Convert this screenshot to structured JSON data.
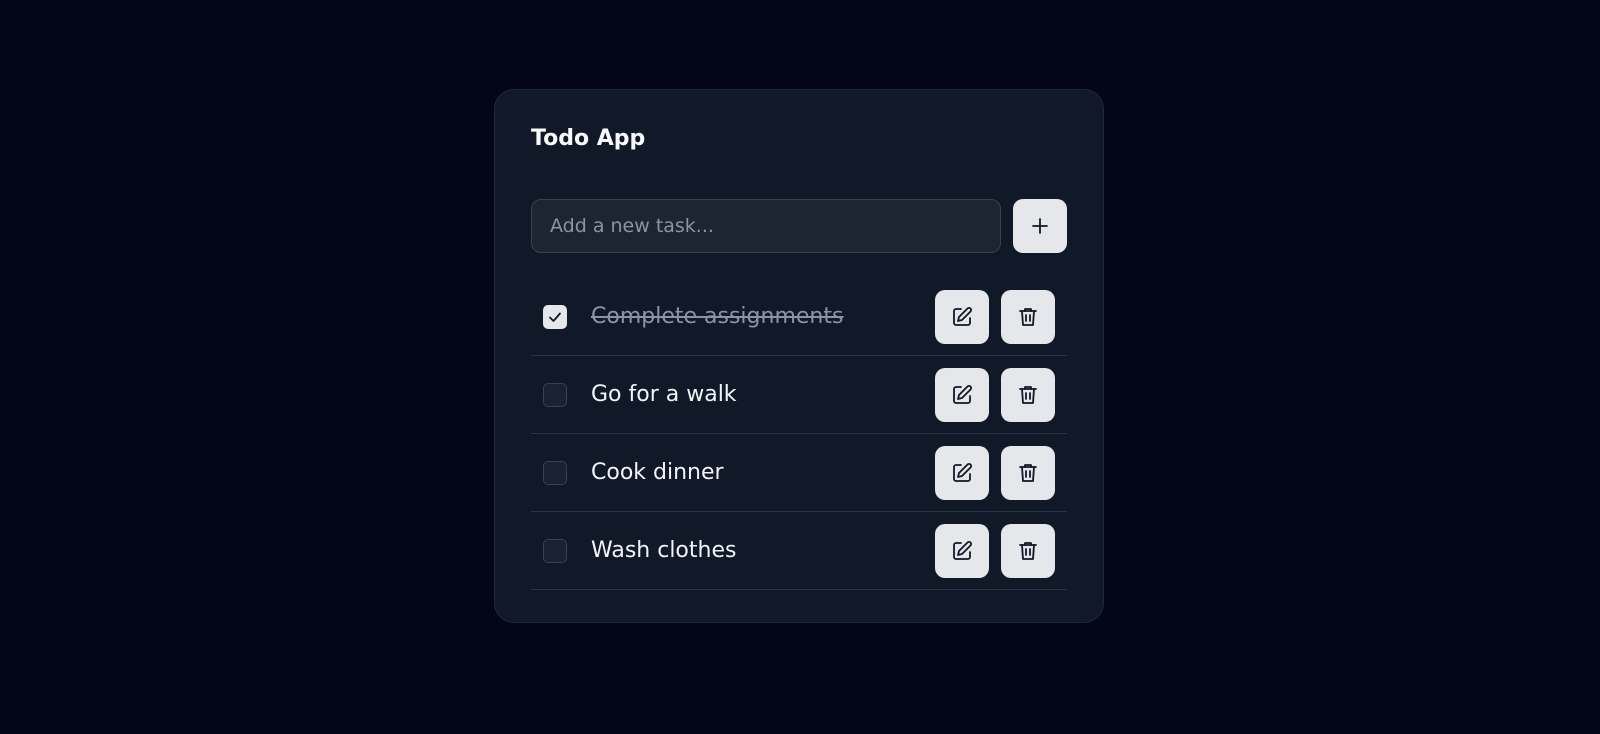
{
  "app": {
    "title": "Todo App"
  },
  "add_task": {
    "placeholder": "Add a new task...",
    "value": "",
    "button_icon": "plus-icon"
  },
  "tasks": [
    {
      "label": "Complete assignments",
      "completed": true
    },
    {
      "label": "Go for a walk",
      "completed": false
    },
    {
      "label": "Cook dinner",
      "completed": false
    },
    {
      "label": "Wash clothes",
      "completed": false
    }
  ],
  "icons": {
    "edit": "edit-icon",
    "delete": "trash-icon",
    "check": "checkmark-icon"
  },
  "colors": {
    "background": "#020617",
    "card": "#111827",
    "button": "#e5e7eb",
    "text": "#f1f5f9",
    "muted": "#8a94a6"
  }
}
